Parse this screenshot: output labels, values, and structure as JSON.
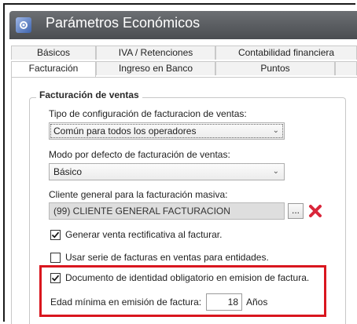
{
  "window": {
    "title": "Parámetros Económicos"
  },
  "tabs_row1": [
    "Básicos",
    "IVA / Retenciones",
    "Contabilidad financiera"
  ],
  "tabs_row2": [
    "Facturación",
    "Ingreso en Banco",
    "Puntos"
  ],
  "active_tab": "Facturación",
  "group": {
    "title": "Facturación de ventas",
    "tipo_label": "Tipo de configuración de facturacion de ventas:",
    "tipo_value": "Común para todos los operadores",
    "modo_label": "Modo por defecto de facturación de ventas:",
    "modo_value": "Básico",
    "cliente_label": "Cliente general para la facturación masiva:",
    "cliente_value": "(99) CLIENTE GENERAL FACTURACION",
    "browse_label": "...",
    "rectificativa_label": "Generar venta rectificativa al facturar.",
    "rectificativa_checked": true,
    "serie_label": "Usar serie de facturas en ventas para entidades.",
    "serie_checked": false,
    "documento_label": "Documento de identidad obligatorio en emision de factura.",
    "documento_checked": true,
    "edad_label": "Edad mínima en emisión de factura:",
    "edad_value": "18",
    "edad_unit": "Años"
  },
  "colors": {
    "highlight": "#d9161e",
    "titlebar": "#5a5d61",
    "delete_x": "#d9263a"
  },
  "icons": [
    "settings-window-icon",
    "chevron-down-icon",
    "delete-x-icon",
    "checkmark-icon"
  ]
}
